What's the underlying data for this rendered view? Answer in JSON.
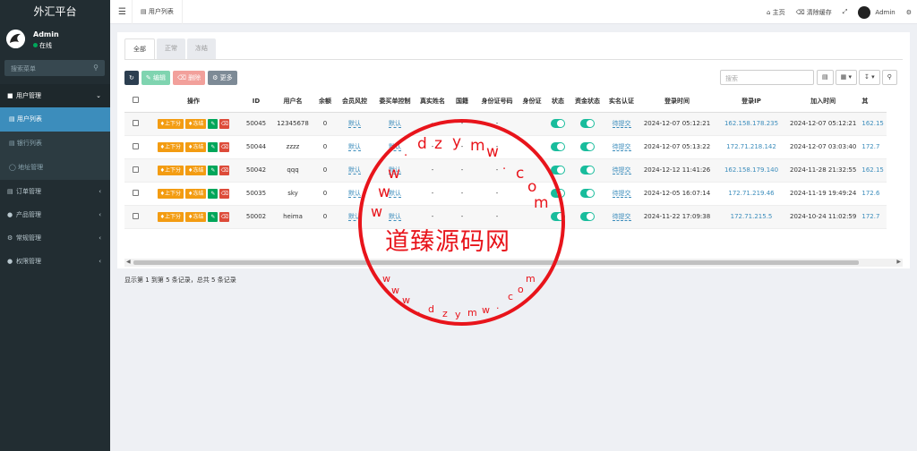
{
  "app": {
    "title": "外汇平台"
  },
  "user": {
    "name": "Admin",
    "status": "在线"
  },
  "sidebar": {
    "search_placeholder": "搜索菜单",
    "items": [
      {
        "label": "用户管理",
        "icon": "user-icon",
        "open": true
      },
      {
        "label": "订单管理",
        "icon": "list-icon"
      },
      {
        "label": "产品管理",
        "icon": "product-icon"
      },
      {
        "label": "常规管理",
        "icon": "settings-icon"
      },
      {
        "label": "权限管理",
        "icon": "group-icon"
      }
    ],
    "subitems": [
      {
        "label": "用户列表",
        "active": true
      },
      {
        "label": "银行列表"
      },
      {
        "label": "地址管理"
      }
    ]
  },
  "topbar": {
    "tab_label": "用户列表",
    "home": "主页",
    "clear_cache": "清除缓存",
    "admin": "Admin"
  },
  "tabs": [
    "全部",
    "正常",
    "冻结"
  ],
  "toolbar": {
    "edit": "编辑",
    "delete": "删除",
    "more": "更多",
    "search_placeholder": "搜索"
  },
  "table": {
    "headers": [
      "操作",
      "ID",
      "用户名",
      "余额",
      "会员风控",
      "委买单控制",
      "真实姓名",
      "国籍",
      "身份证号码",
      "身份证",
      "状态",
      "资金状态",
      "实名认证",
      "登录时间",
      "登录IP",
      "加入时间",
      "其"
    ],
    "action_labels": {
      "updown": "上下分",
      "freeze": "冻结"
    },
    "rows": [
      {
        "id": "50045",
        "username": "12345678",
        "balance": "0",
        "risk": "默认",
        "order_ctrl": "默认",
        "real_name": "-",
        "nationality": "-",
        "id_number": "-",
        "verify": "待提交",
        "login_time": "2024-12-07 05:12:21",
        "login_ip": "162.158.178.235",
        "join_time": "2024-12-07 05:12:21",
        "extra": "162.15"
      },
      {
        "id": "50044",
        "username": "zzzz",
        "balance": "0",
        "risk": "默认",
        "order_ctrl": "默认",
        "real_name": "-",
        "nationality": "-",
        "id_number": "-",
        "verify": "待提交",
        "login_time": "2024-12-07 05:13:22",
        "login_ip": "172.71.218.142",
        "join_time": "2024-12-07 03:03:40",
        "extra": "172.7"
      },
      {
        "id": "50042",
        "username": "qqq",
        "balance": "0",
        "risk": "默认",
        "order_ctrl": "默认",
        "real_name": "-",
        "nationality": "-",
        "id_number": "-",
        "verify": "待提交",
        "login_time": "2024-12-12 11:41:26",
        "login_ip": "162.158.179.140",
        "join_time": "2024-11-28 21:32:55",
        "extra": "162.15"
      },
      {
        "id": "50035",
        "username": "sky",
        "balance": "0",
        "risk": "默认",
        "order_ctrl": "默认",
        "real_name": "-",
        "nationality": "-",
        "id_number": "-",
        "verify": "待提交",
        "login_time": "2024-12-05 16:07:14",
        "login_ip": "172.71.219.46",
        "join_time": "2024-11-19 19:49:24",
        "extra": "172.6"
      },
      {
        "id": "50002",
        "username": "heima",
        "balance": "0",
        "risk": "默认",
        "order_ctrl": "默认",
        "real_name": "-",
        "nationality": "-",
        "id_number": "-",
        "verify": "待提交",
        "login_time": "2024-11-22 17:09:38",
        "login_ip": "172.71.215.5",
        "join_time": "2024-10-24 11:02:59",
        "extra": "172.7"
      }
    ]
  },
  "footer": "显示第 1 到第 5 条记录，总共 5 条记录",
  "watermark": {
    "title": "道臻源码网",
    "top_chars": [
      "w",
      "w",
      "w",
      ".",
      "d",
      "z",
      "y",
      "m",
      "w",
      ".",
      "c",
      "o",
      "m"
    ],
    "bottom_text": "w w w . d z y m w . c o m"
  }
}
